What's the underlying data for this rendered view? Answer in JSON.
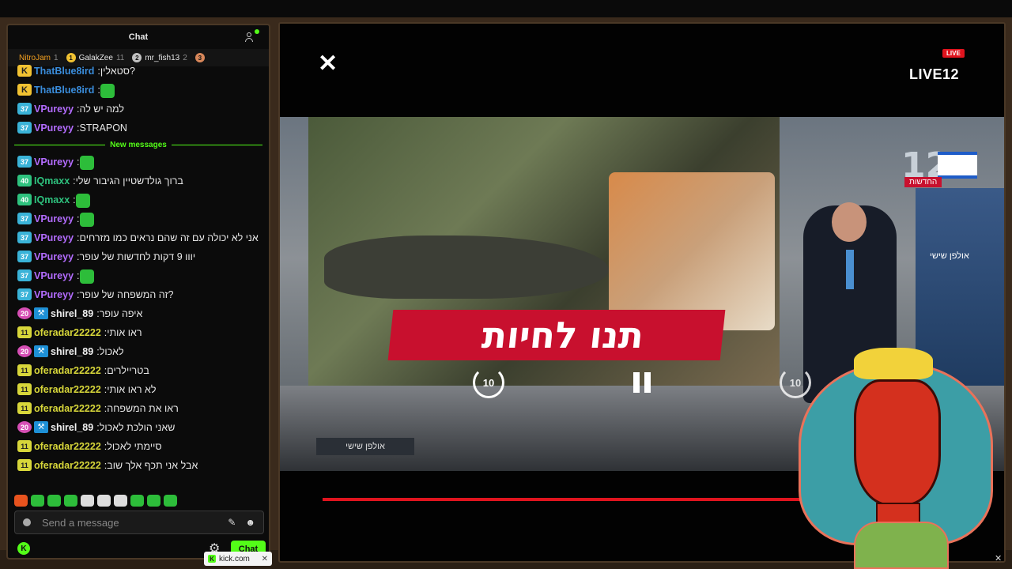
{
  "chat": {
    "title": "Chat",
    "leaderboard": [
      {
        "name": "NitroJam",
        "count": "1",
        "medal": "",
        "color": "#f4a020"
      },
      {
        "name": "GalakZee",
        "count": "11",
        "medal": "1",
        "color": "#f1c232"
      },
      {
        "name": "mr_fish13",
        "count": "2",
        "medal": "2",
        "color": "#c0c0c0"
      },
      {
        "name": "",
        "count": "",
        "medal": "3",
        "color": "#d8875a"
      }
    ],
    "messages_before": [
      {
        "badge": "K",
        "user": "ThatBlue8ird",
        "text": "?סטאלין",
        "user_color": "#3a8ddc"
      },
      {
        "badge": "K",
        "user": "ThatBlue8ird",
        "text": "",
        "emote": true,
        "user_color": "#3a8ddc"
      },
      {
        "badge": "37",
        "user": "VPureyy",
        "text": "למה יש לה",
        "user_color": "#b36cff"
      },
      {
        "badge": "37",
        "user": "VPureyy",
        "text": "STRAPON",
        "user_color": "#b36cff"
      }
    ],
    "new_messages_label": "New messages",
    "messages_after": [
      {
        "badge": "37",
        "user": "VPureyy",
        "text": "",
        "emote": true,
        "user_color": "#b36cff"
      },
      {
        "badge": "40",
        "user": "IQmaxx",
        "text": "ברוך גולדשטיין הגיבור שלי",
        "user_color": "#2ec27e"
      },
      {
        "badge": "40",
        "user": "IQmaxx",
        "text": "",
        "emote": true,
        "user_color": "#2ec27e"
      },
      {
        "badge": "37",
        "user": "VPureyy",
        "text": "",
        "emote": true,
        "user_color": "#b36cff"
      },
      {
        "badge": "37",
        "user": "VPureyy",
        "text": "אני לא יכולה עם זה שהם נראים כמו מזרחים",
        "user_color": "#b36cff"
      },
      {
        "badge": "37",
        "user": "VPureyy",
        "text": "יווו 9 דקות לחדשות של עופר",
        "user_color": "#b36cff"
      },
      {
        "badge": "37",
        "user": "VPureyy",
        "text": "",
        "emote": true,
        "user_color": "#b36cff"
      },
      {
        "badge": "37",
        "user": "VPureyy",
        "text": "?זה המשפחה של עופר",
        "user_color": "#b36cff"
      },
      {
        "badge": "20",
        "tool": true,
        "user": "shirel_89",
        "text": "איפה עופר",
        "user_color": "#f0f0f0"
      },
      {
        "badge": "11",
        "user": "oferadar22222",
        "text": "ראו אותי",
        "user_color": "#d7d63a"
      },
      {
        "badge": "20",
        "tool": true,
        "user": "shirel_89",
        "text": "לאכול",
        "user_color": "#f0f0f0"
      },
      {
        "badge": "11",
        "user": "oferadar22222",
        "text": "בטריילרים",
        "user_color": "#d7d63a"
      },
      {
        "badge": "11",
        "user": "oferadar22222",
        "text": "לא ראו אותי",
        "user_color": "#d7d63a"
      },
      {
        "badge": "11",
        "user": "oferadar22222",
        "text": "ראו את המשפחה",
        "user_color": "#d7d63a"
      },
      {
        "badge": "20",
        "tool": true,
        "user": "shirel_89",
        "text": "שאני הולכת לאכול",
        "user_color": "#f0f0f0"
      },
      {
        "badge": "11",
        "user": "oferadar22222",
        "text": "סיימתי לאכול",
        "user_color": "#d7d63a"
      },
      {
        "badge": "11",
        "user": "oferadar22222",
        "text": "אבל אני תכף אלך שוב",
        "user_color": "#d7d63a"
      }
    ],
    "input_placeholder": "Send a message",
    "send_label": "Chat"
  },
  "video": {
    "live_label": "LIVE",
    "channel": "LIVE12",
    "headline": "תנו לחיות",
    "headline_highlight": "לחיות",
    "news_tag": "החדשות",
    "show_name": "אולפן שישי",
    "side_screen_text": "אולפן שישי",
    "rewind_label": "10",
    "forward_label": "10",
    "progress": 0.83,
    "logo_number": "12"
  },
  "tab": {
    "url": "kick.com"
  },
  "colors": {
    "accent": "#53fc18",
    "live": "#e0141e"
  }
}
